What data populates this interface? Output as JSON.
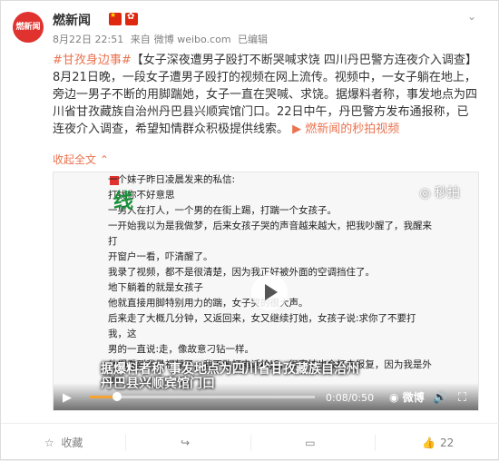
{
  "post": {
    "avatar_text": "燃新闻",
    "username": "燃新闻",
    "date": "8月22日 22:51",
    "source_prefix": "来自",
    "source": "微博 weibo.com",
    "edited": "已编辑",
    "hashtag": "#甘孜身边事#",
    "body_1": "【女子深夜遭男子殴打不断哭喊求饶 四川丹巴警方连夜介入调查】8月21日晚，一段女子遭男子殴打的视频在网上流传。视频中，一女子躺在地上，旁边一男子不断的用脚踹她，女子一直在哭喊、求饶。据爆料者称，事发地点为四川省甘孜藏族自治州丹巴县兴顺宾馆门口。22日中午，丹巴警方发布通报称，已连夜介入调查，希望知情群众积极提供线索。",
    "video_link": "燃新闻的秒拍视频",
    "collapse": "收起全文",
    "collapse_icon": "chevron-up-icon"
  },
  "video": {
    "lines": [
      "一个妹子昨日凌晨发来的私信:",
      "打扰你不好意思",
      "一男人在打人，一个男的在街上踢，打踹一个女孩子。",
      "一开始我以为是我做梦，后来女孩子哭的声音越来越大，把我吵醒了，我醒来打",
      "开窗户一看，吓清醒了。",
      "我录了视频，都不是很清楚，因为我正好被外面的空调挡住了。",
      "地下躺着的就是女孩子",
      "他就直接用脚特别用力的踹，女子哭的很大声。",
      "后来走了大概几分钟，又返回来，女又继续打她，女孩子说:求你了不要打我，这",
      "男的一直说:走，像故意刁钻一样。",
      "他们看到我录视频了，我不敢打电话给JC，很害怕也会打击报复，因为我是外地"
    ],
    "green_text": "线",
    "watermark": "秒拍",
    "subtitle_1": "据爆料者称 事发地点为四川省甘孜藏族自治州",
    "subtitle_2": "丹巴县兴顺宾馆门口",
    "time": "0:08/0:50",
    "brand": "微博",
    "progress": 0.12
  },
  "footer": {
    "collect": "收藏",
    "repost": "",
    "comment": "",
    "like": "22"
  }
}
